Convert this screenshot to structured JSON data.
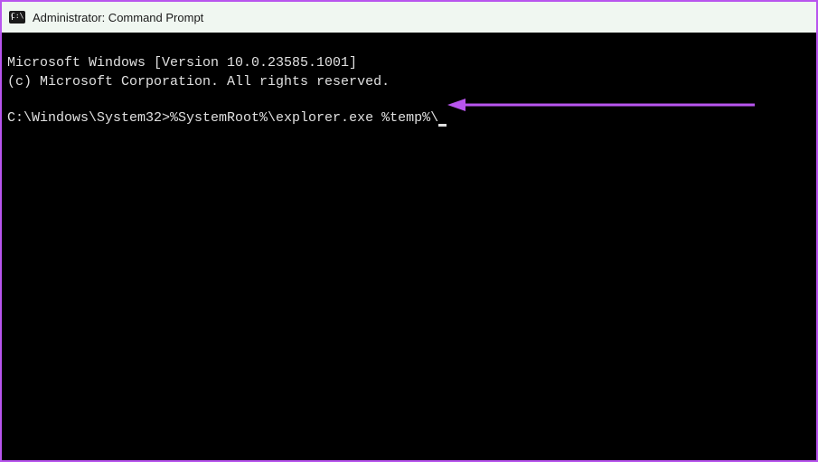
{
  "titlebar": {
    "icon": "cmd-icon",
    "title": "Administrator: Command Prompt"
  },
  "terminal": {
    "line1": "Microsoft Windows [Version 10.0.23585.1001]",
    "line2": "(c) Microsoft Corporation. All rights reserved.",
    "blank": "",
    "prompt": "C:\\Windows\\System32>",
    "command": "%SystemRoot%\\explorer.exe %temp%\\"
  },
  "annotation": {
    "arrow_color": "#b855ee"
  }
}
